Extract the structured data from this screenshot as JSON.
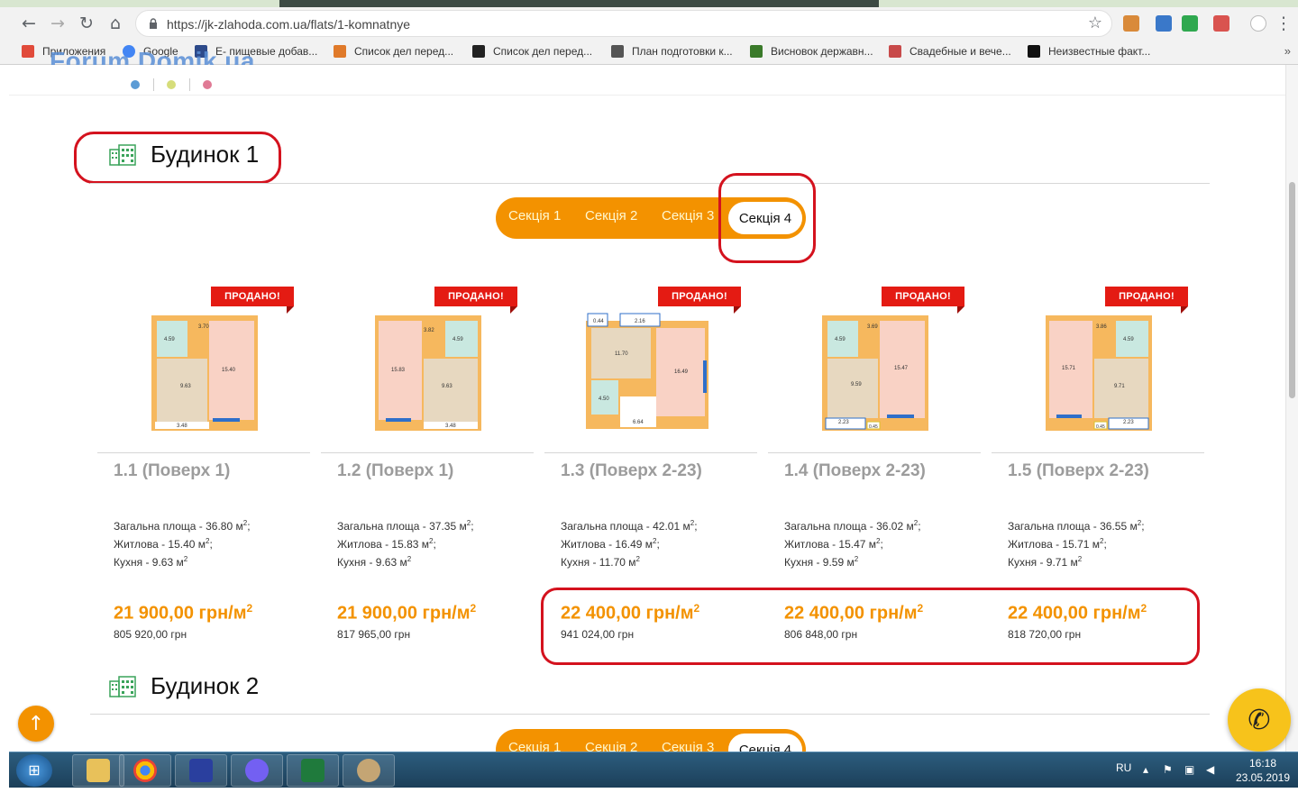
{
  "browser": {
    "url": "https://jk-zlahoda.com.ua/flats/1-komnatnye",
    "bookmarks": [
      {
        "label": "Приложения",
        "color": "#e14b3b"
      },
      {
        "label": "Google",
        "color": "#4285f4"
      },
      {
        "label": "E- пищевые добав...",
        "color": "#2d4a8a"
      },
      {
        "label": "Список дел перед...",
        "color": "#e07a2a"
      },
      {
        "label": "Список дел перед...",
        "color": "#222222"
      },
      {
        "label": "План подготовки к...",
        "color": "#555555"
      },
      {
        "label": "Висновок державн...",
        "color": "#3a7a2a"
      },
      {
        "label": "Свадебные и вече...",
        "color": "#c84a4a"
      },
      {
        "label": "Неизвестные факт...",
        "color": "#111111"
      }
    ],
    "more": "»"
  },
  "watermark": "Forum.Domik.ua",
  "buildings": [
    {
      "title": "Будинок 1",
      "tabs": [
        "Секція 1",
        "Секція 2",
        "Секція 3",
        "Секція 4"
      ],
      "active_tab": "Секція 4"
    },
    {
      "title": "Будинок 2",
      "tabs": [
        "Секція 1",
        "Секція 2",
        "Секція 3",
        "Секція 4"
      ],
      "active_tab": "Секція 4"
    }
  ],
  "flats": [
    {
      "title": "1.1 (Поверх 1)",
      "badge": "ПРОДАНО!",
      "total_area": "Загальна площа - 36.80 м",
      "living_area": "Житлова - 15.40 м",
      "kitchen": "Кухня - 9.63 м",
      "price_per_m2": "21 900,00 грн/м",
      "total_price": "805 920,00 грн",
      "plan_labels": [
        "4.59",
        "3.70",
        "15.40",
        "9.63",
        "3.48"
      ]
    },
    {
      "title": "1.2 (Поверх 1)",
      "badge": "ПРОДАНО!",
      "total_area": "Загальна площа - 37.35 м",
      "living_area": "Житлова - 15.83 м",
      "kitchen": "Кухня - 9.63 м",
      "price_per_m2": "21 900,00 грн/м",
      "total_price": "817 965,00 грн",
      "plan_labels": [
        "15.83",
        "3.82",
        "4.59",
        "9.63",
        "3.48"
      ]
    },
    {
      "title": "1.3 (Поверх 2-23)",
      "badge": "ПРОДАНО!",
      "total_area": "Загальна площа - 42.01 м",
      "living_area": "Житлова - 16.49 м",
      "kitchen": "Кухня - 11.70 м",
      "price_per_m2": "22 400,00 грн/м",
      "total_price": "941 024,00 грн",
      "plan_labels": [
        "0.44",
        "2.16",
        "11.70",
        "16.49",
        "4.50",
        "6.64"
      ]
    },
    {
      "title": "1.4 (Поверх 2-23)",
      "badge": "ПРОДАНО!",
      "total_area": "Загальна площа - 36.02 м",
      "living_area": "Житлова - 15.47 м",
      "kitchen": "Кухня - 9.59 м",
      "price_per_m2": "22 400,00 грн/м",
      "total_price": "806 848,00 грн",
      "plan_labels": [
        "4.59",
        "3.69",
        "15.47",
        "9.59",
        "2.23",
        "0.45"
      ]
    },
    {
      "title": "1.5 (Поверх 2-23)",
      "badge": "ПРОДАНО!",
      "total_area": "Загальна площа - 36.55 м",
      "living_area": "Житлова - 15.71 м",
      "kitchen": "Кухня - 9.71 м",
      "price_per_m2": "22 400,00 грн/м",
      "total_price": "818 720,00 грн",
      "plan_labels": [
        "15.71",
        "3.86",
        "4.59",
        "9.71",
        "0.45",
        "2.23"
      ]
    }
  ],
  "sup": "2",
  "taskbar": {
    "lang": "RU",
    "time": "16:18",
    "date": "23.05.2019"
  },
  "colors": {
    "accent": "#f39200",
    "sold": "#e41b13",
    "annotation": "#d4121e"
  }
}
